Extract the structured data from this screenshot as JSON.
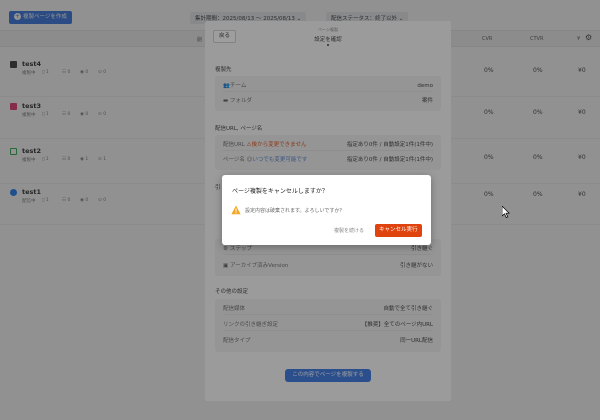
{
  "toolbar": {
    "create_button": "複製ページを作成",
    "period_filter": "集計期間：2025/08/13 ～ 2025/08/13",
    "status_filter": "配信ステータス：終了以外"
  },
  "table": {
    "columns": [
      "削",
      "CVR",
      "CTVR",
      "¥"
    ],
    "rows": [
      {
        "name": "test4",
        "state": "複製中",
        "stats": [
          "1",
          "0",
          "0",
          "0"
        ],
        "cvr": "0%",
        "ctvr": "0%",
        "cost": "¥0",
        "icon_color": "#333333"
      },
      {
        "name": "test3",
        "state": "複製中",
        "stats": [
          "1",
          "0",
          "0",
          "0"
        ],
        "cvr": "0%",
        "ctvr": "0%",
        "cost": "¥0",
        "icon_color": "#e1306c"
      },
      {
        "name": "test2",
        "state": "複製中",
        "stats": [
          "1",
          "0",
          "1",
          "1"
        ],
        "cvr": "0%",
        "ctvr": "0%",
        "cost": "¥0",
        "icon_color": "#22a745"
      },
      {
        "name": "test1",
        "state": "配信中",
        "stats": [
          "1",
          "0",
          "0",
          "0"
        ],
        "cvr": "0%",
        "ctvr": "0%",
        "cost": "¥0",
        "icon_color": "#1877f2"
      }
    ]
  },
  "wizard": {
    "back": "戻る",
    "step_label": "ページ複製",
    "title": "設定を確認",
    "sections": {
      "copy_target": {
        "title": "複製先",
        "team_label": "チーム",
        "team_value": "demo",
        "folder_label": "フォルダ",
        "folder_value": "案件"
      },
      "delivery": {
        "title": "配信URL, ページ名",
        "url_label": "配信URL",
        "url_note": "後から変更できません",
        "url_value": "指定あり0件 / 自動設定1件(1件中)",
        "page_label": "ページ名",
        "page_note": "いつでも変更可能です",
        "page_value": "指定あり0件 / 自動設定1件(1件中)"
      },
      "hidden": {
        "title": "引",
        "step_label": "ステップ",
        "step_value": "引き継ぐ",
        "archive_label": "アーカイブ済みVersion",
        "archive_value": "引き継がない"
      },
      "other": {
        "title": "その他の設定",
        "media_label": "配信媒体",
        "media_value": "自動で全て引き継ぐ",
        "link_label": "リンクの引き継ぎ設定",
        "link_value": "【推奨】全てのページ内URL",
        "type_label": "配信タイプ",
        "type_value": "同一URL配信"
      }
    },
    "submit": "この内容でページを複製する"
  },
  "confirm": {
    "title": "ページ複製をキャンセルしますか？",
    "message": "設定内容は破棄されます。よろしいですか？",
    "continue": "複製を続ける",
    "execute": "キャンセル実行"
  }
}
